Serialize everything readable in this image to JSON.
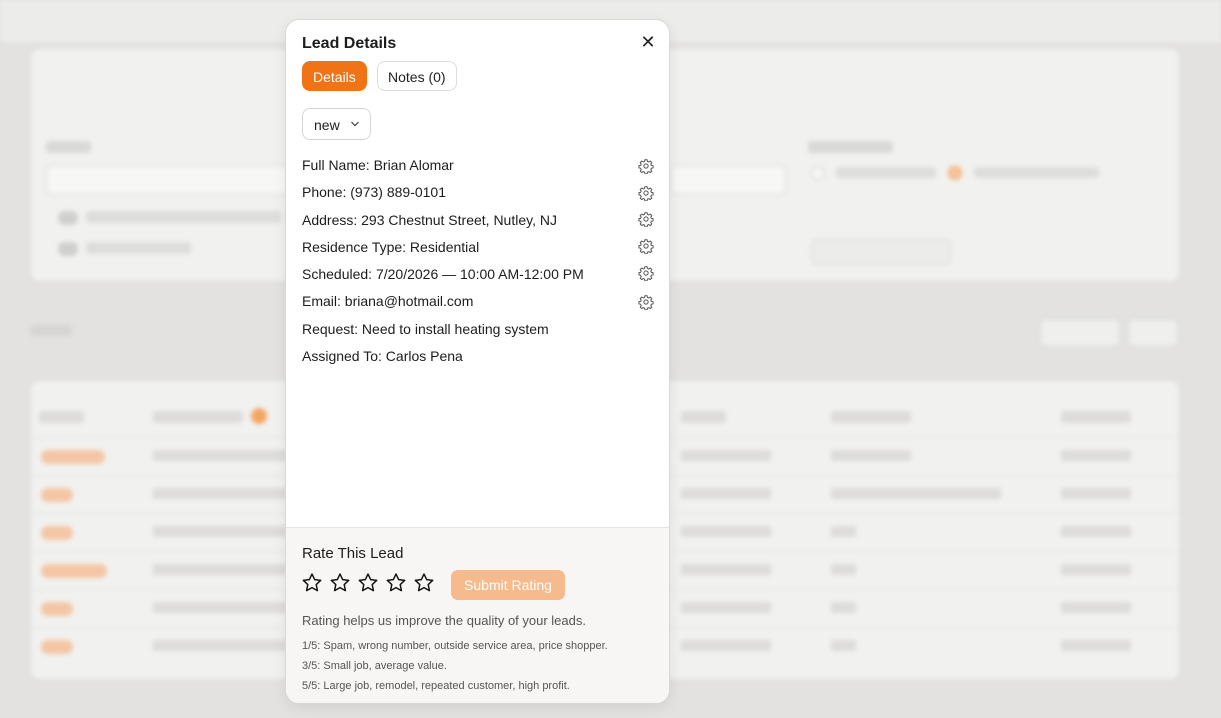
{
  "modal": {
    "title": "Lead Details",
    "tabs": [
      {
        "label": "Details",
        "active": true
      },
      {
        "label": "Notes (0)",
        "active": false
      }
    ],
    "status": "new",
    "fields": [
      {
        "text": "Full Name: Brian Alomar",
        "editable": true
      },
      {
        "text": "Phone: (973) 889-0101",
        "editable": true
      },
      {
        "text": "Address: 293 Chestnut Street, Nutley, NJ",
        "editable": true
      },
      {
        "text": "Residence Type: Residential",
        "editable": true
      },
      {
        "text": "Scheduled: 7/20/2026 — 10:00 AM-12:00 PM",
        "editable": true
      },
      {
        "text": "Email: briana@hotmail.com",
        "editable": true
      },
      {
        "text": "Request: Need to install heating system",
        "editable": false
      },
      {
        "text": "Assigned To: Carlos Pena",
        "editable": false
      }
    ],
    "rating": {
      "title": "Rate This Lead",
      "stars": 5,
      "selected": 0,
      "submit_label": "Submit Rating",
      "helper": "Rating helps us improve the quality of your leads.",
      "notes": [
        "1/5: Spam, wrong number, outside service area, price shopper.",
        "3/5: Small job, average value.",
        "5/5: Large job, remodel, repeated customer, high profit."
      ]
    }
  },
  "colors": {
    "accent": "#f07316",
    "accent_disabled": "#f6ba8c",
    "backdrop": "#e3e2e1"
  },
  "icons": {
    "close": "close-icon",
    "chevron": "chevron-down-icon",
    "field_action": "gear-icon",
    "rating": "star-icon"
  }
}
